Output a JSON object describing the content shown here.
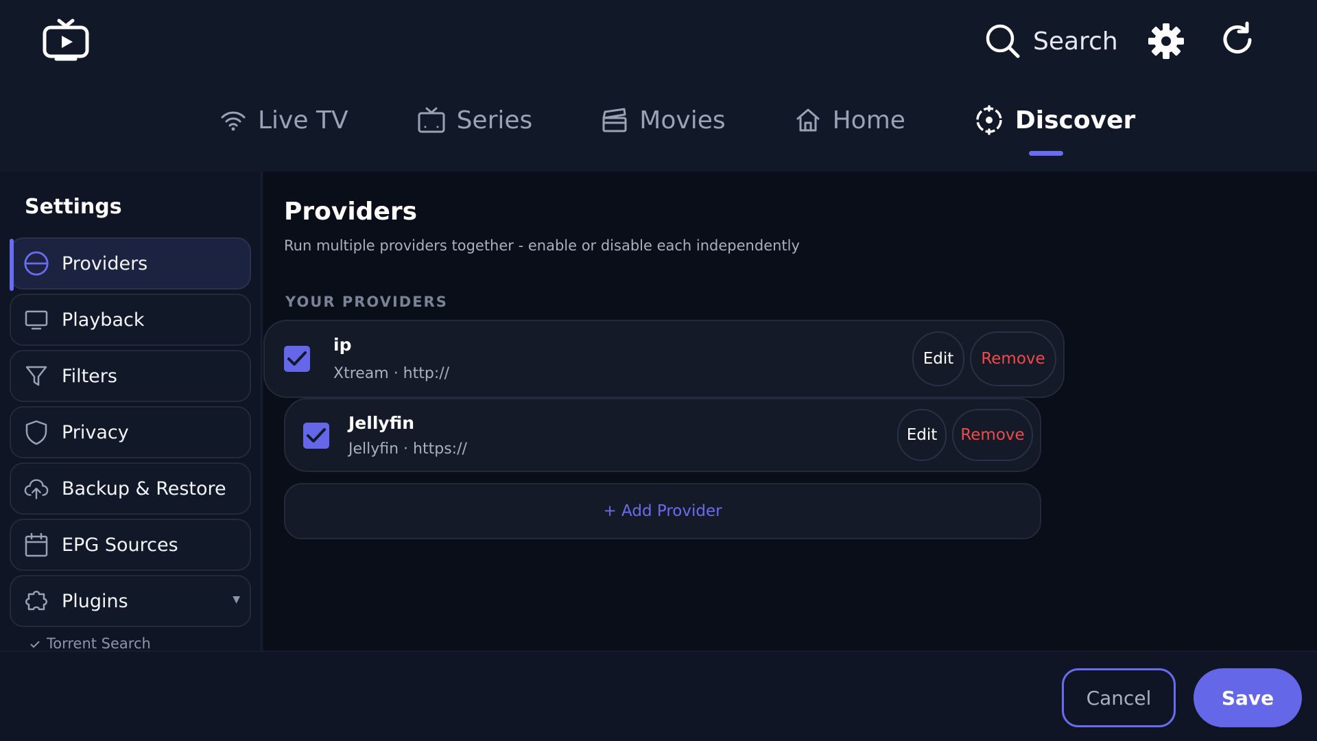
{
  "header": {
    "logo_icon": "tv-play-icon",
    "search_label": "Search",
    "settings_icon": "gear-icon",
    "refresh_icon": "refresh-icon"
  },
  "nav": {
    "tabs": [
      {
        "label": "Live TV",
        "icon": "wifi-icon",
        "active": false
      },
      {
        "label": "Series",
        "icon": "tv-icon",
        "active": false
      },
      {
        "label": "Movies",
        "icon": "clapperboard-icon",
        "active": false
      },
      {
        "label": "Home",
        "icon": "home-icon",
        "active": false
      },
      {
        "label": "Discover",
        "icon": "compass-icon",
        "active": true
      }
    ]
  },
  "sidebar": {
    "title": "Settings",
    "items": [
      {
        "label": "Providers",
        "icon": "globe-icon",
        "active": true
      },
      {
        "label": "Playback",
        "icon": "monitor-icon",
        "active": false
      },
      {
        "label": "Filters",
        "icon": "filter-icon",
        "active": false
      },
      {
        "label": "Privacy",
        "icon": "shield-icon",
        "active": false
      },
      {
        "label": "Backup & Restore",
        "icon": "cloud-upload-icon",
        "active": false
      },
      {
        "label": "EPG Sources",
        "icon": "calendar-icon",
        "active": false
      },
      {
        "label": "Plugins",
        "icon": "puzzle-icon",
        "active": false
      }
    ],
    "sub_items": [
      {
        "label": "Torrent Search",
        "icon": "check-icon"
      }
    ]
  },
  "main": {
    "title": "Providers",
    "subtitle": "Run multiple providers together - enable or disable each independently",
    "section_label": "YOUR PROVIDERS",
    "providers": [
      {
        "name": "ip",
        "meta": "Xtream · http://",
        "enabled": true,
        "edit_label": "Edit",
        "remove_label": "Remove"
      },
      {
        "name": "Jellyfin",
        "meta": "Jellyfin · https://",
        "enabled": true,
        "edit_label": "Edit",
        "remove_label": "Remove"
      }
    ],
    "add_label": "+ Add Provider"
  },
  "footer": {
    "cancel_label": "Cancel",
    "save_label": "Save"
  },
  "colors": {
    "accent": "#6a6cf0",
    "danger": "#ef4b4b",
    "background": "#0f1524"
  }
}
